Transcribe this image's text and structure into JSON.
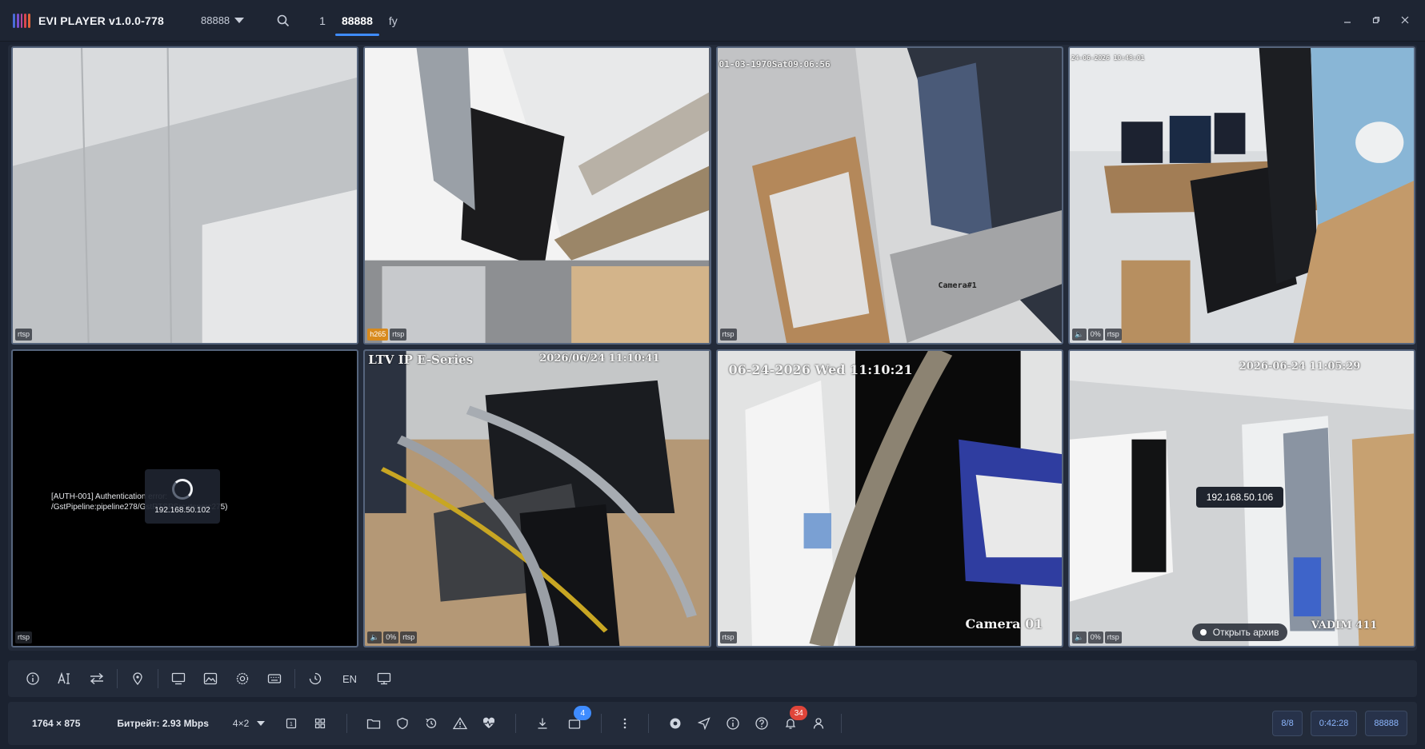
{
  "app": {
    "title": "EVI PLAYER v1.0.0-778",
    "profile": "88888"
  },
  "tabs": [
    {
      "label": "1"
    },
    {
      "label": "88888"
    },
    {
      "label": "fy"
    }
  ],
  "cells": [
    {
      "badges": [
        "rtsp"
      ]
    },
    {
      "badges": [
        "h265",
        "rtsp"
      ]
    },
    {
      "overlay": "01-03-1970Sat09:06:56",
      "badges": [
        "rtsp"
      ],
      "label_small": "Camera#1"
    },
    {
      "overlay": "24-06-2026 10:48:01",
      "badges": [
        "0%",
        "rtsp"
      ]
    },
    {
      "error": "[AUTH-001] Authentication error: /GstPipeline:pipeline278/GstRTSPSrc:rtspsrc275)",
      "loader_ip": "192.168.50.102",
      "badges": [
        "rtsp"
      ]
    },
    {
      "overlay": "LTV IP E-Series",
      "overlay2": "2026/06/24 11:10:41",
      "badges": [
        "0%",
        "rtsp"
      ]
    },
    {
      "overlay": "06-24-2026 Wed 11:10:21",
      "overlay2": "Camera 01",
      "badges": [
        "rtsp"
      ]
    },
    {
      "overlay": "2026-06-24 11:05:29",
      "overlay2": "VADIM 411",
      "tooltip_ip": "192.168.50.106",
      "archive": "Открыть архив",
      "badges": [
        "0%",
        "rtsp"
      ]
    }
  ],
  "toolbar": {
    "lang": "EN"
  },
  "status": {
    "resolution": "1764 × 875",
    "bitrate": "Битрейт: 2.93 Mbps",
    "layout": "4×2",
    "downloads_count": "4",
    "notifications_count": "34",
    "pill_count": "8/8",
    "pill_time": "0:42:28",
    "pill_user": "88888"
  },
  "colors": {
    "accent": "#3f8cff",
    "danger": "#e0453a",
    "badge_orange": "#d88a1d"
  }
}
